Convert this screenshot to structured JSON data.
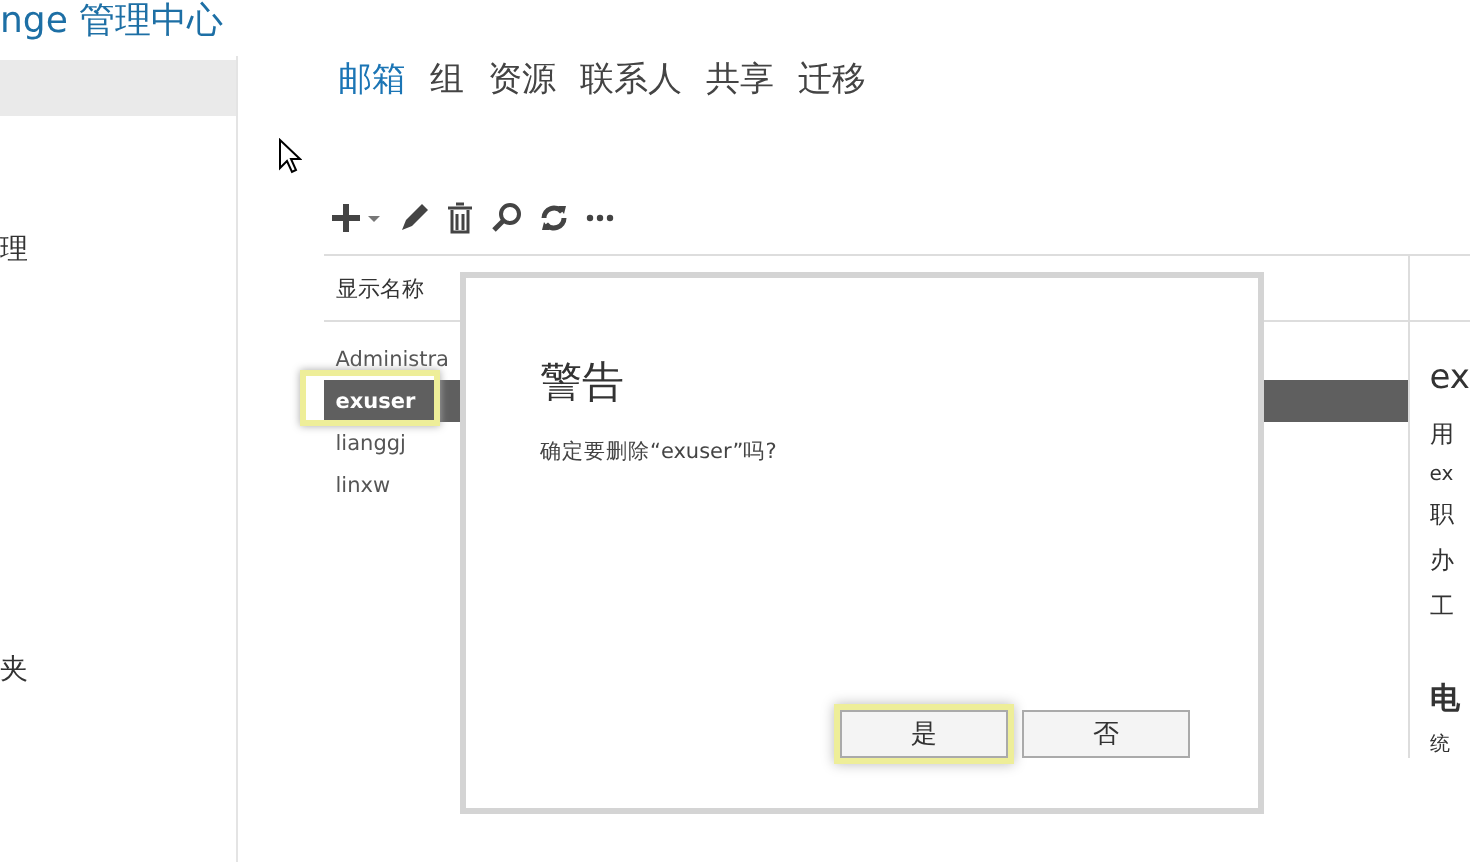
{
  "header": {
    "title": "nge 管理中心"
  },
  "sidebar": {
    "items": [
      {
        "label": "理"
      },
      {
        "label": "夹"
      }
    ]
  },
  "tabs": [
    {
      "label": "邮箱",
      "selected": true
    },
    {
      "label": "组",
      "selected": false
    },
    {
      "label": "资源",
      "selected": false
    },
    {
      "label": "联系人",
      "selected": false
    },
    {
      "label": "共享",
      "selected": false
    },
    {
      "label": "迁移",
      "selected": false
    }
  ],
  "table": {
    "columns": [
      "显示名称"
    ],
    "rows": [
      {
        "name": "Administra",
        "selected": false,
        "highlighted": false
      },
      {
        "name": "exuser",
        "selected": true,
        "highlighted": true
      },
      {
        "name": "lianggj",
        "selected": false,
        "highlighted": false
      },
      {
        "name": "linxw",
        "selected": false,
        "highlighted": false
      }
    ]
  },
  "details": {
    "title": "ex",
    "lines": [
      {
        "kind": "label",
        "text": "用"
      },
      {
        "kind": "value",
        "text": "ex"
      },
      {
        "kind": "label",
        "text": "职"
      },
      {
        "kind": "label",
        "text": "办"
      },
      {
        "kind": "label",
        "text": "工"
      },
      {
        "kind": "heading",
        "text": "电"
      },
      {
        "kind": "value",
        "text": "统"
      }
    ]
  },
  "dialog": {
    "title": "警告",
    "message": "确定要删除“exuser”吗?",
    "buttons": [
      {
        "label": "是",
        "highlighted": true
      },
      {
        "label": "否",
        "highlighted": false
      }
    ]
  }
}
